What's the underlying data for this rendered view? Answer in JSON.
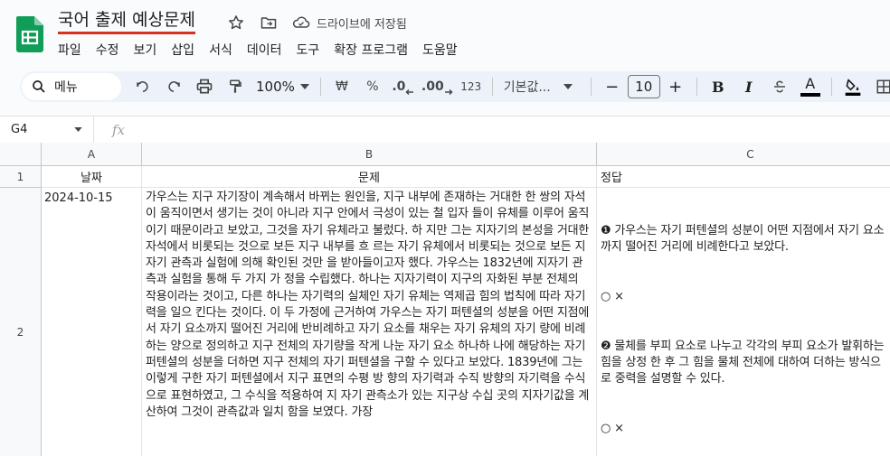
{
  "document": {
    "title": "국어 출제 예상문제",
    "save_status": "드라이브에 저장됨",
    "icons": [
      "star-icon",
      "move-to-folder-icon",
      "cloud-saved-icon"
    ]
  },
  "menu": [
    "파일",
    "수정",
    "보기",
    "삽입",
    "서식",
    "데이터",
    "도구",
    "확장 프로그램",
    "도움말"
  ],
  "toolbar": {
    "search_label": "메뉴",
    "zoom": "100%",
    "currency": "₩",
    "percent": "%",
    "decrease_decimal": ".0",
    "increase_decimal": ".00",
    "number_format": "123",
    "font_family": "기본값...",
    "font_size": "10",
    "decrease_font": "−",
    "increase_font": "+",
    "bold": "B",
    "italic": "I",
    "text_color": "A"
  },
  "formula_bar": {
    "name_box": "G4",
    "fx": "fx"
  },
  "sheet": {
    "columns": [
      "A",
      "B",
      "C"
    ],
    "rows": [
      "1",
      "2"
    ],
    "header_row": [
      "날짜",
      "문제",
      "정답"
    ],
    "row2": {
      "date": "2024-10-15",
      "question": "가우스는 지구 자기장이 계속해서 바뀌는 원인을, 지구 내부에 존재하는 거대한 한 쌍의 자석이 움직이면서 생기는 것이 아니라 지구 안에서 극성이 있는 철 입자 들이 유체를 이루어 움직이기 때문이라고 보았고, 그것을 자기 유체라고 불렀다. 하 지만 그는 지자기의 본성을 거대한 자석에서 비롯되는 것으로 보든 지구 내부를 흐 르는 자기 유체에서 비롯되는 것으로 보든 지자기 관측과 실험에 의해 확인된 것만 을 받아들이고자 했다. 가우스는 1832년에 지자기 관측과 실험을 통해 두 가지 가 정을 수립했다. 하나는 지자기력이 지구의 자화된 부분 전체의 작용이라는 것이고, 다른 하나는 자기력의 실체인 자기 유체는 역제곱 힘의 법칙에 따라 자기력을 일으 킨다는 것이다. 이 두 가정에 근거하여 가우스는 자기 퍼텐셜의 성분을 어떤 지점에 서 자기 요소까지 떨어진 거리에 반비례하고 자기 요소를 채우는 자기 유체의 자기 량에 비례하는 양으로 정의하고 지구 전체의 자기량을 작게 나눈 자기 요소 하나하 나에 해당하는 자기 퍼텐셜의 성분을 더하면 지구 전체의 자기 퍼텐셜을 구할 수 있다고 보았다. 1839년에 그는 이렇게 구한 자기 퍼텐셜에서 지구 표면의 수평 방 향의 자기력과 수직 방향의 자기력을 수식으로 표현하였고, 그 수식을 적용하여 지 자기 관측소가 있는 지구상 수십 곳의 지자기값을 계산하여 그것이 관측값과 일치 함을 보였다. 가장",
      "answer_line1": "❶ 가우스는 자기 퍼텐셜의 성분이 어떤 지점에서 자기 요소까지 떨어진 거리에 비례한다고 보았다.",
      "answer_mark1": "○ ×",
      "answer_line2": "❷ 물체를 부피 요소로 나누고 각각의 부피 요소가 발휘하는 힘을 상정 한 후 그 힘을 물체 전체에 대하여 더하는 방식으로 중력을 설명할 수 있다.",
      "answer_mark2": "○ ×"
    }
  },
  "colors": {
    "sheets_green": "#0f9d58",
    "title_underline": "#d93025",
    "toolbar_bg": "#edf2fa"
  }
}
